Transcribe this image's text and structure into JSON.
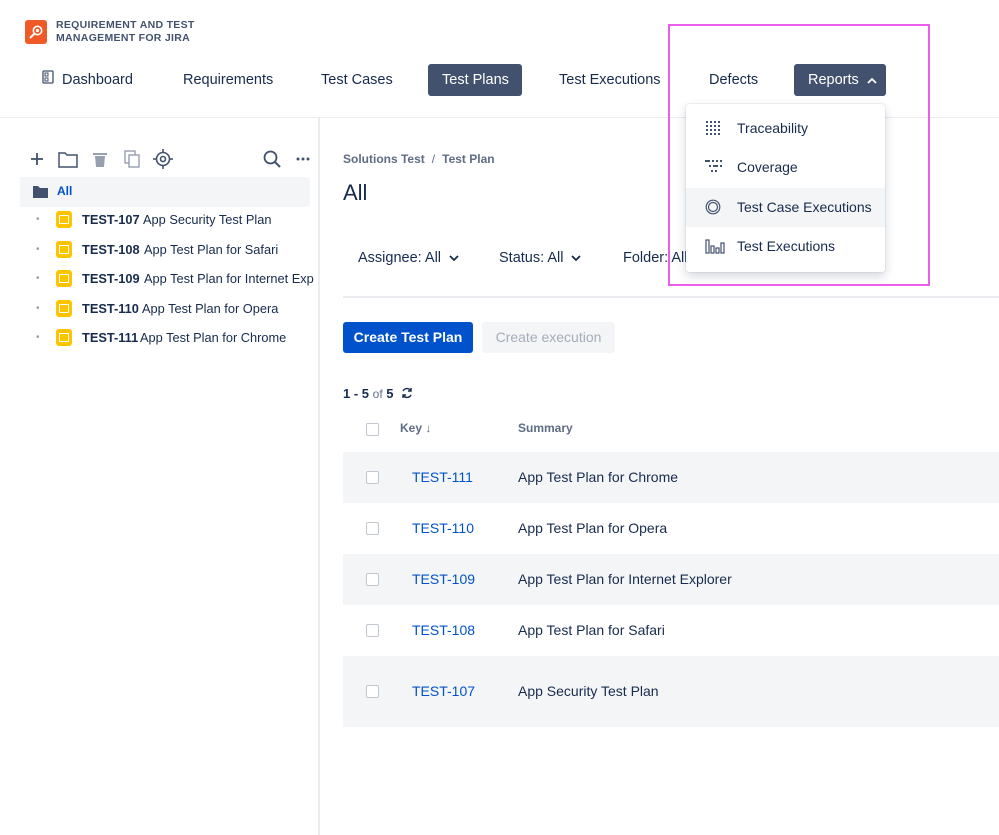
{
  "app": {
    "brand_line1": "REQUIREMENT AND TEST",
    "brand_line2": "MANAGEMENT FOR JIRA",
    "logo_icon": "magnifier-bug-icon",
    "accent_color": "#f05a28"
  },
  "nav": {
    "dashboard": "Dashboard",
    "requirements": "Requirements",
    "test_cases": "Test Cases",
    "test_plans": "Test Plans",
    "test_executions": "Test Executions",
    "defects": "Defects",
    "reports": "Reports",
    "active": "Test Plans"
  },
  "reports_menu": {
    "items": [
      {
        "label": "Traceability",
        "icon": "grid-dots-icon"
      },
      {
        "label": "Coverage",
        "icon": "coverage-icon"
      },
      {
        "label": "Test Case Executions",
        "icon": "target-rings-icon"
      },
      {
        "label": "Test Executions",
        "icon": "bar-chart-icon"
      }
    ],
    "hovered": "Test Case Executions"
  },
  "sidebar": {
    "toolbar_icons": [
      "plus-icon",
      "folder-icon",
      "trash-icon",
      "copy-icon",
      "crosshair-icon",
      "search-icon",
      "more-icon"
    ],
    "root_label": "All",
    "items": [
      {
        "key": "TEST-107",
        "name": "App Security Test Plan"
      },
      {
        "key": "TEST-108",
        "name": "App Test Plan for Safari"
      },
      {
        "key": "TEST-109",
        "name": "App Test Plan for Internet Exp"
      },
      {
        "key": "TEST-110",
        "name": "App Test Plan for Opera"
      },
      {
        "key": "TEST-111",
        "name": "App Test Plan for Chrome"
      }
    ]
  },
  "main": {
    "breadcrumb": [
      "Solutions Test",
      "Test Plan"
    ],
    "breadcrumb_sep": "/",
    "title": "All",
    "filters": {
      "assignee": "Assignee: All",
      "status": "Status: All",
      "folder": "Folder: All"
    },
    "create_button": "Create Test Plan",
    "create_execution_button": "Create execution",
    "pager": {
      "range": "1 - 5",
      "of": "of",
      "total": "5"
    },
    "table": {
      "headers": {
        "key": "Key ↓",
        "summary": "Summary"
      },
      "rows": [
        {
          "key": "TEST-111",
          "summary": "App Test Plan for Chrome"
        },
        {
          "key": "TEST-110",
          "summary": "App Test Plan for Opera"
        },
        {
          "key": "TEST-109",
          "summary": "App Test Plan for Internet Explorer"
        },
        {
          "key": "TEST-108",
          "summary": "App Test Plan for Safari"
        },
        {
          "key": "TEST-107",
          "summary": "App Security Test Plan"
        }
      ]
    }
  },
  "colors": {
    "nav_active_bg": "#42526e",
    "primary": "#0052cc",
    "plan_icon": "#ffc400",
    "highlight": "#e95fe9"
  }
}
